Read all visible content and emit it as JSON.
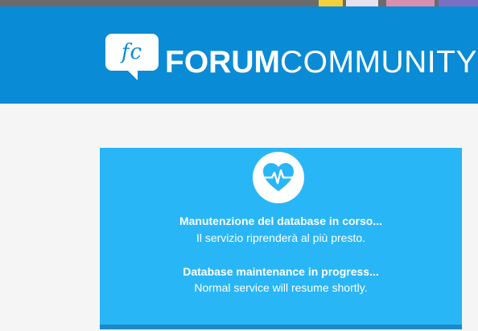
{
  "header": {
    "logo_initials": "fc",
    "logo_bold": "FORUM",
    "logo_light": "COMMUNITY"
  },
  "maintenance": {
    "icon": "heart-pulse-icon",
    "italian_title": "Manutenzione del database in corso...",
    "italian_subtitle": "Il servizio riprenderà al più presto.",
    "english_title": "Database maintenance in progress...",
    "english_subtitle": "Normal service will resume shortly."
  },
  "colors": {
    "header_bg": "#0a8bd6",
    "card_bg": "#29b6f6",
    "card_border": "#1e88c7",
    "page_bg": "#f5f5f5",
    "icon_heart": "#29b6f6"
  }
}
